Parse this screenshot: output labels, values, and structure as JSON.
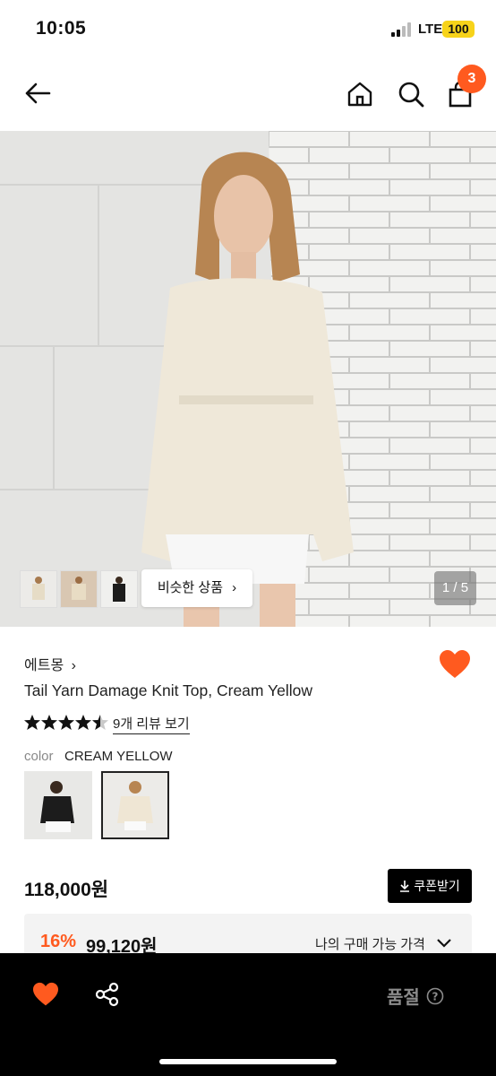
{
  "status_bar": {
    "time": "10:05",
    "network": "LTE",
    "battery": "100"
  },
  "header": {
    "cart_count": "3"
  },
  "gallery": {
    "page_indicator": "1 / 5",
    "similar_button": "비슷한 상품"
  },
  "product": {
    "brand": "에트몽",
    "title": "Tail Yarn Damage Knit Top, Cream Yellow",
    "rating": 4.5,
    "review_link": "9개 리뷰 보기",
    "color_label": "color",
    "color_value": "CREAM YELLOW",
    "price": "118,000원",
    "coupon_button": "쿠폰받기",
    "discount_percent": "16%",
    "sale_price": "99,120원",
    "my_price_label": "나의 구매 가능 가격"
  },
  "bottom_bar": {
    "status": "품절"
  },
  "colors": {
    "accent": "#ff5a1f",
    "battery": "#f7d31a"
  }
}
